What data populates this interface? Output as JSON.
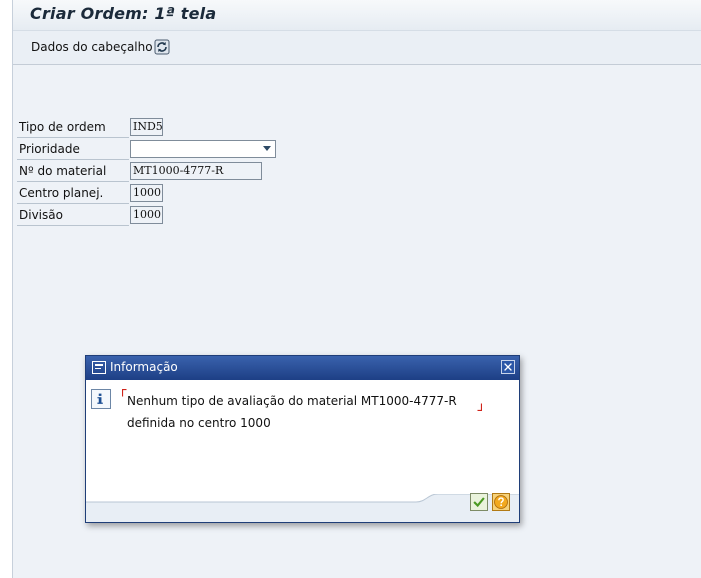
{
  "window": {
    "title": "Criar Ordem: 1ª tela"
  },
  "toolbar": {
    "header_data_label": "Dados do cabeçalho",
    "icon": "refresh-icon"
  },
  "form": {
    "fields": [
      {
        "label": "Tipo de ordem",
        "value": "IND5"
      },
      {
        "label": "Prioridade",
        "value": ""
      },
      {
        "label": "Nº do material",
        "value": "MT1000-4777-R"
      },
      {
        "label": "Centro planej.",
        "value": "1000"
      },
      {
        "label": "Divisão",
        "value": "1000"
      }
    ]
  },
  "dialog": {
    "title": "Informação",
    "message_line1": "Nenhum tipo de avaliação do material MT1000-4777-R",
    "message_line2": "definida no centro 1000",
    "icons": {
      "info": "info-icon",
      "ok": "check-icon",
      "help": "help-icon",
      "close": "close-icon"
    }
  },
  "colors": {
    "dialog_title": "#1d3f85",
    "background": "#eef2f7",
    "ok_green": "#5aa02c",
    "help_orange": "#f0a31c"
  }
}
